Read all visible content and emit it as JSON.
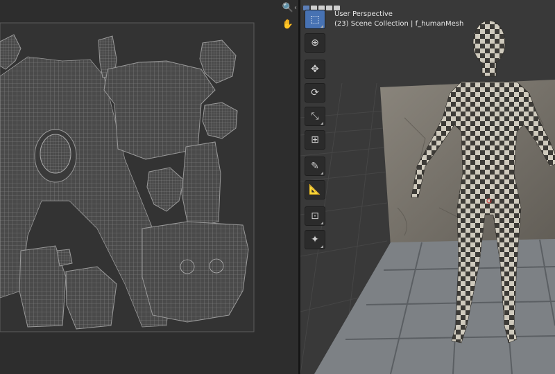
{
  "uv_editor": {
    "tools": [
      {
        "name": "zoom-icon",
        "glyph": "🔍"
      },
      {
        "name": "hand-pan-icon",
        "glyph": "✋"
      }
    ]
  },
  "viewport": {
    "overlay_title": "User Perspective",
    "overlay_subtitle": "(23) Scene Collection | f_humanMesh",
    "toolbar": [
      {
        "name": "select-box-tool",
        "glyph": "⬚",
        "active": true
      },
      {
        "name": "cursor-tool",
        "glyph": "⊕"
      },
      {
        "name": "move-tool",
        "glyph": "✥"
      },
      {
        "name": "rotate-tool",
        "glyph": "⟳"
      },
      {
        "name": "scale-tool",
        "glyph": "⤡"
      },
      {
        "name": "transform-tool",
        "glyph": "⊞"
      },
      {
        "name": "annotate-tool",
        "glyph": "✎"
      },
      {
        "name": "measure-tool",
        "glyph": "📐"
      },
      {
        "name": "add-cube-tool",
        "glyph": "⊡"
      },
      {
        "name": "edit-tool",
        "glyph": "✦"
      }
    ]
  }
}
